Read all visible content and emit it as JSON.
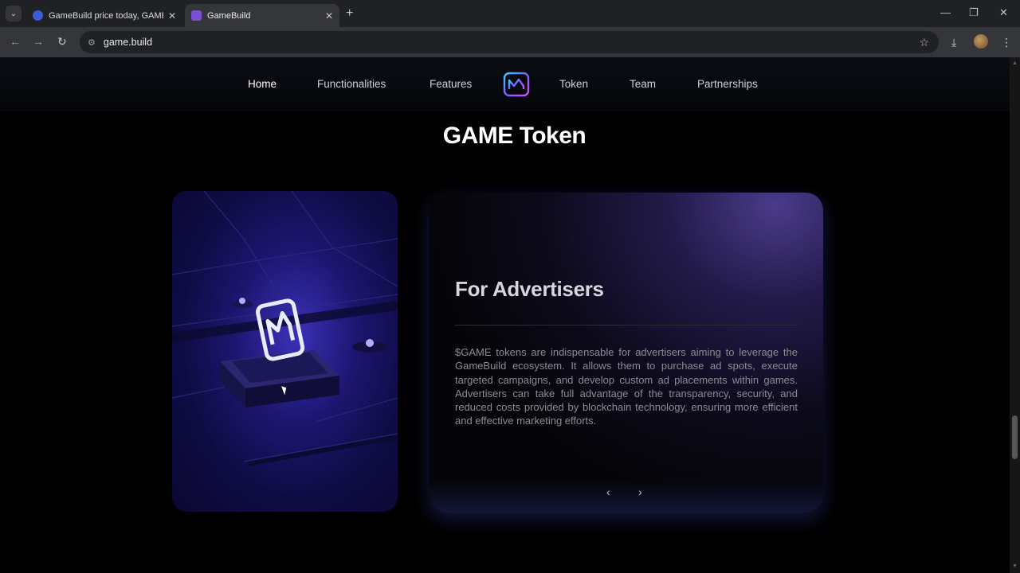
{
  "browser": {
    "tabs": [
      {
        "title": "GameBuild price today, GAME t",
        "active": false,
        "favicon_color": "#3b5bdb"
      },
      {
        "title": "GameBuild",
        "active": true,
        "favicon_color": "#7b4fd6"
      }
    ],
    "new_tab_symbol": "+",
    "close_symbol": "✕",
    "url": "game.build",
    "window_controls": {
      "minimize": "—",
      "maximize": "❐",
      "close": "✕"
    }
  },
  "site": {
    "nav": {
      "items": [
        "Home",
        "Functionalities",
        "Features",
        "Token",
        "Team",
        "Partnerships"
      ],
      "active": "Home"
    },
    "section_title": "GAME Token",
    "card": {
      "heading": "For Advertisers",
      "body": "$GAME tokens are indispensable for advertisers aiming to leverage the GameBuild ecosystem. It allows them to purchase ad spots, execute targeted campaigns, and develop custom ad placements within games. Advertisers can take full advantage of the transparency, security, and reduced costs provided by blockchain technology, ensuring more efficient and effective marketing efforts.",
      "prev_symbol": "‹",
      "next_symbol": "›"
    }
  },
  "colors": {
    "accent_purple": "#7b5cff",
    "accent_blue": "#3a6cff",
    "page_bg": "#000000"
  }
}
